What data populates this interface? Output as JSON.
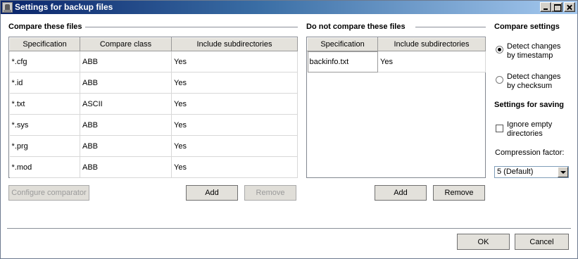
{
  "window": {
    "title": "Settings for backup files"
  },
  "compare": {
    "title": "Compare these files",
    "columns": [
      "Specification",
      "Compare class",
      "Include subdirectories"
    ],
    "rows": [
      [
        "*.cfg",
        "ABB",
        "Yes"
      ],
      [
        "*.id",
        "ABB",
        "Yes"
      ],
      [
        "*.txt",
        "ASCII",
        "Yes"
      ],
      [
        "*.sys",
        "ABB",
        "Yes"
      ],
      [
        "*.prg",
        "ABB",
        "Yes"
      ],
      [
        "*.mod",
        "ABB",
        "Yes"
      ]
    ],
    "configure_label": "Configure comparator",
    "add_label": "Add",
    "remove_label": "Remove"
  },
  "nocompare": {
    "title": "Do not compare these files",
    "columns": [
      "Specification",
      "Include subdirectories"
    ],
    "rows": [
      [
        "backinfo.txt",
        "Yes"
      ]
    ],
    "add_label": "Add",
    "remove_label": "Remove"
  },
  "settings": {
    "compare_title": "Compare settings",
    "option_timestamp": "Detect changes by timestamp",
    "option_checksum": "Detect changes by checksum",
    "selected_option": "timestamp",
    "saving_title": "Settings for saving",
    "ignore_empty_label": "Ignore empty directories",
    "ignore_empty_checked": false,
    "compression_label": "Compression factor:",
    "compression_value": "5 (Default)"
  },
  "footer": {
    "ok_label": "OK",
    "cancel_label": "Cancel"
  }
}
